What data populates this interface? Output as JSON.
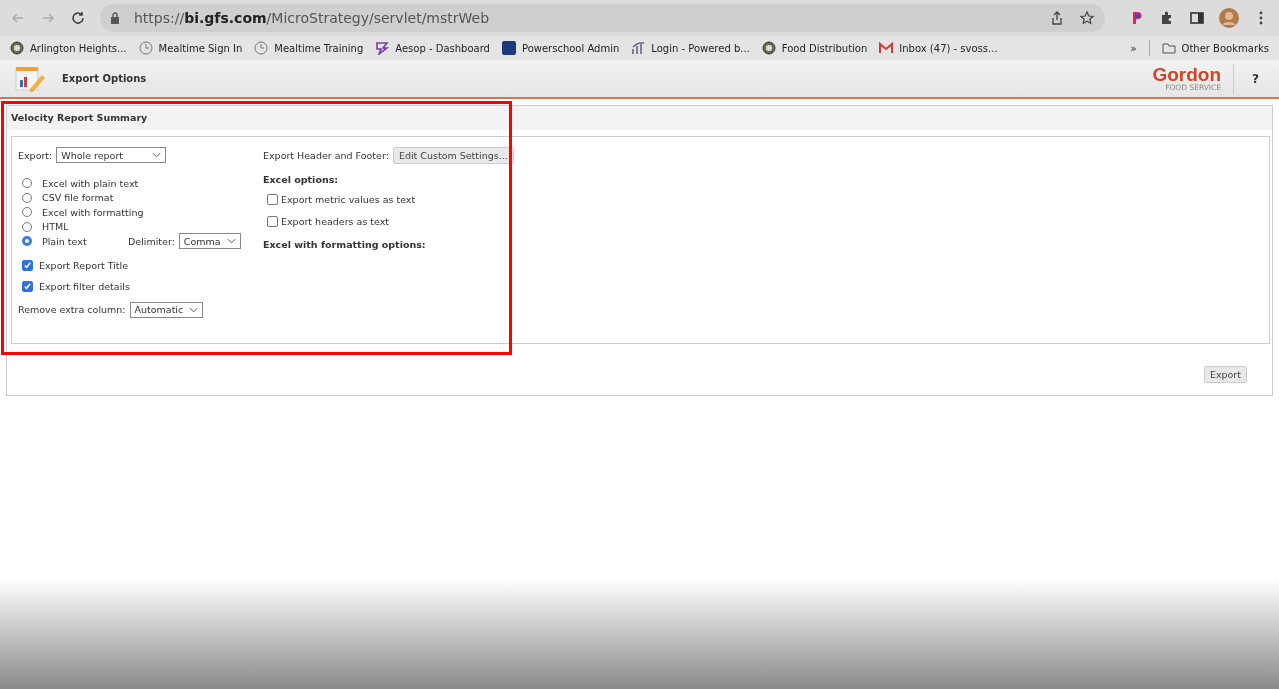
{
  "browser": {
    "url_prefix": "https://",
    "url_host": "bi.gfs.com",
    "url_path": "/MicroStrategy/servlet/mstrWeb",
    "bookmarks": [
      {
        "label": "Arlington Heights...",
        "kind": "seal"
      },
      {
        "label": "Mealtime Sign In",
        "kind": "clock"
      },
      {
        "label": "Mealtime Training",
        "kind": "clock"
      },
      {
        "label": "Aesop - Dashboard",
        "kind": "aesop"
      },
      {
        "label": "Powerschool Admin",
        "kind": "sis"
      },
      {
        "label": "Login - Powered b...",
        "kind": "bars"
      },
      {
        "label": "Food Distribution",
        "kind": "seal"
      },
      {
        "label": "Inbox (47) - svoss...",
        "kind": "mail"
      }
    ],
    "overflow": "»",
    "other_bookmarks": "Other Bookmarks"
  },
  "app_header": {
    "title": "Export Options",
    "logo_name": "Gordon",
    "logo_sub": "FOOD SERVICE",
    "help": "?"
  },
  "panel": {
    "title": "Velocity Report Summary",
    "export_label": "Export:",
    "export_value": "Whole report",
    "formats": [
      {
        "label": "Excel with plain text",
        "selected": false
      },
      {
        "label": "CSV file format",
        "selected": false
      },
      {
        "label": "Excel with formatting",
        "selected": false
      },
      {
        "label": "HTML",
        "selected": false
      },
      {
        "label": "Plain text",
        "selected": true
      }
    ],
    "delimiter_label": "Delimiter:",
    "delimiter_value": "Comma",
    "options": [
      {
        "label": "Export Report Title",
        "checked": true
      },
      {
        "label": "Export filter details",
        "checked": true
      }
    ],
    "remove_label": "Remove extra column:",
    "remove_value": "Automatic",
    "header_footer_label": "Export Header and Footer:",
    "header_footer_button": "Edit Custom Settings...",
    "excel_options_title": "Excel options:",
    "excel_options": [
      {
        "label": "Export metric values as text",
        "checked": false
      },
      {
        "label": "Export headers as text",
        "checked": false
      }
    ],
    "formatting_options_title": "Excel with formatting options:",
    "export_button": "Export"
  }
}
